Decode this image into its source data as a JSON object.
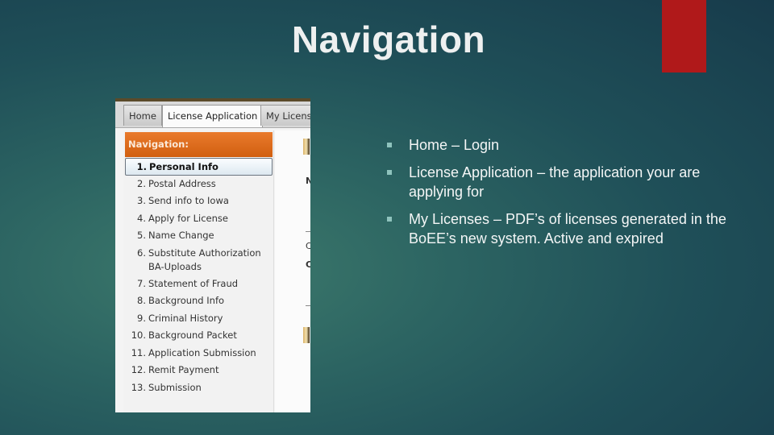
{
  "slide": {
    "title": "Navigation",
    "accent_color": "#b0191a"
  },
  "screenshot": {
    "tabs": [
      {
        "label": "Home",
        "active": false
      },
      {
        "label": "License Application",
        "active": true
      },
      {
        "label": "My Licens",
        "active": false
      }
    ],
    "nav_header": "Navigation:",
    "nav_items": [
      {
        "num": "1.",
        "label": "Personal Info",
        "selected": true
      },
      {
        "num": "2.",
        "label": "Postal Address"
      },
      {
        "num": "3.",
        "label": "Send info to Iowa"
      },
      {
        "num": "4.",
        "label": "Apply for License"
      },
      {
        "num": "5.",
        "label": "Name Change"
      },
      {
        "num": "6.",
        "label": "Substitute Authorization BA-Uploads"
      },
      {
        "num": "7.",
        "label": "Statement of Fraud"
      },
      {
        "num": "8.",
        "label": "Background Info"
      },
      {
        "num": "9.",
        "label": "Criminal History"
      },
      {
        "num": "10.",
        "label": "Background Packet"
      },
      {
        "num": "11.",
        "label": "Application Submission"
      },
      {
        "num": "12.",
        "label": "Remit Payment"
      },
      {
        "num": "13.",
        "label": "Submission"
      }
    ],
    "content_letters": [
      "N",
      "C",
      "C"
    ]
  },
  "bullets": [
    "Home – Login",
    "License Application – the application your are applying for",
    "My Licenses – PDF’s of licenses generated in the BoEE’s new system. Active and expired"
  ]
}
